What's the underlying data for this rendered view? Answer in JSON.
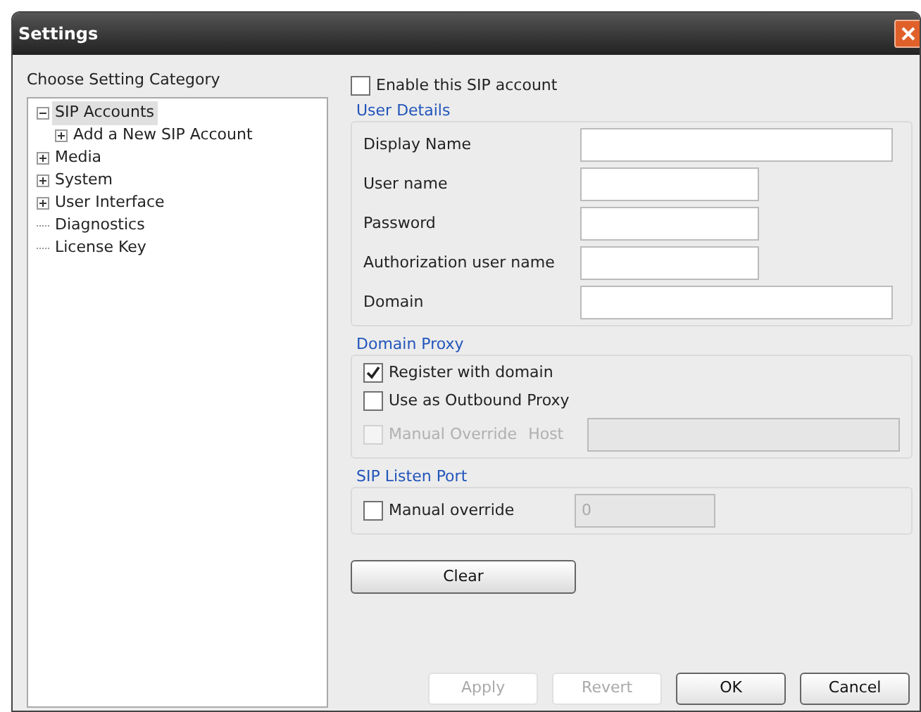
{
  "window": {
    "title": "Settings"
  },
  "sidebar": {
    "label": "Choose Setting Category",
    "items": [
      {
        "label": "SIP Accounts",
        "kind": "branch",
        "expanded": true,
        "selected": true,
        "children": [
          {
            "label": "Add a New SIP Account",
            "kind": "branch",
            "expanded": false,
            "selected": false
          }
        ]
      },
      {
        "label": "Media",
        "kind": "branch",
        "expanded": false,
        "selected": false
      },
      {
        "label": "System",
        "kind": "branch",
        "expanded": false,
        "selected": false
      },
      {
        "label": "User Interface",
        "kind": "branch",
        "expanded": false,
        "selected": false
      },
      {
        "label": "Diagnostics",
        "kind": "leaf",
        "selected": false
      },
      {
        "label": "License Key",
        "kind": "leaf",
        "selected": false
      }
    ]
  },
  "enable": {
    "label": "Enable this SIP account",
    "checked": false
  },
  "user_details": {
    "title": "User Details",
    "fields": [
      {
        "label": "Display Name",
        "kind": "wide"
      },
      {
        "label": "User name",
        "kind": "narrow"
      },
      {
        "label": "Password",
        "kind": "narrow"
      },
      {
        "label": "Authorization user name",
        "kind": "narrow"
      },
      {
        "label": "Domain",
        "kind": "wide"
      }
    ]
  },
  "domain_proxy": {
    "title": "Domain Proxy",
    "options": [
      {
        "label": "Register with domain",
        "checked": true,
        "disabled": false
      },
      {
        "label": "Use as Outbound Proxy",
        "checked": false,
        "disabled": false
      },
      {
        "label": "Manual Override",
        "checked": false,
        "disabled": true
      }
    ],
    "host": {
      "label": "Host",
      "disabled": true
    }
  },
  "listen_port": {
    "title": "SIP Listen Port",
    "option": {
      "label": "Manual override",
      "checked": false,
      "disabled": false
    },
    "port": {
      "value": "0",
      "disabled": true
    }
  },
  "clear_button": "Clear",
  "buttons": [
    {
      "label": "Apply",
      "disabled": true
    },
    {
      "label": "Revert",
      "disabled": true
    },
    {
      "label": "OK",
      "disabled": false
    },
    {
      "label": "Cancel",
      "disabled": false
    }
  ]
}
